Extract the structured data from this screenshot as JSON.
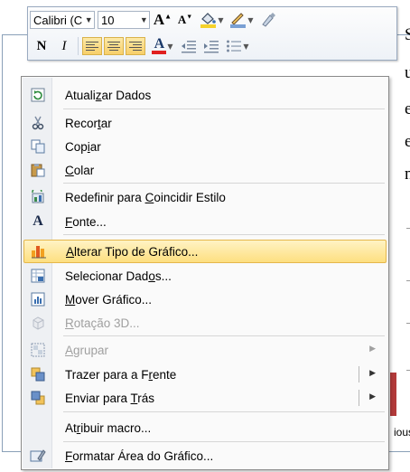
{
  "background": {
    "doc_lines": [
      "S",
      "u",
      "e",
      "e",
      "n"
    ],
    "partial_axis_label": "ious"
  },
  "mini_toolbar": {
    "font_name": "Calibri (C",
    "font_size": "10",
    "grow_font_glyph": "A",
    "shrink_font_glyph": "A",
    "bold_label": "N",
    "italic_label": "I",
    "font_color_glyph": "A",
    "icons": [
      "grow-font-icon",
      "shrink-font-icon",
      "fill-color-icon",
      "line-color-icon",
      "format-painter-icon",
      "bold-icon",
      "italic-icon",
      "align-left-icon",
      "align-center-icon",
      "align-right-icon",
      "font-color-icon",
      "decrease-indent-icon",
      "increase-indent-icon",
      "bullets-icon"
    ],
    "colors": {
      "fill": "#f5d22b",
      "line": "#7aa0d4",
      "font": "#e02020"
    }
  },
  "context_menu": {
    "items": [
      {
        "pre": "Atuali",
        "key": "z",
        "post": "ar Dados",
        "icon": "refresh-data-icon",
        "enabled": true
      },
      {
        "pre": "Recor",
        "key": "t",
        "post": "ar",
        "icon": "cut-icon",
        "enabled": true
      },
      {
        "pre": "Cop",
        "key": "i",
        "post": "ar",
        "icon": "copy-icon",
        "enabled": true
      },
      {
        "pre": "",
        "key": "C",
        "post": "olar",
        "icon": "paste-icon",
        "enabled": true
      },
      {
        "pre": "Redefinir para ",
        "key": "C",
        "post": "oincidir Estilo",
        "icon": "reset-style-icon",
        "enabled": true
      },
      {
        "pre": "",
        "key": "F",
        "post": "onte...",
        "icon": "font-icon",
        "enabled": true
      },
      {
        "pre": "",
        "key": "A",
        "post": "lterar Tipo de Gráfico...",
        "icon": "change-chart-type-icon",
        "enabled": true,
        "highlighted": true
      },
      {
        "pre": "Selecionar Dad",
        "key": "o",
        "post": "s...",
        "icon": "select-data-icon",
        "enabled": true
      },
      {
        "pre": "",
        "key": "M",
        "post": "over Gráfico...",
        "icon": "move-chart-icon",
        "enabled": true
      },
      {
        "pre": "",
        "key": "R",
        "post": "otação 3D...",
        "icon": "rotation-3d-icon",
        "enabled": false
      },
      {
        "pre": "",
        "key": "A",
        "post": "grupar",
        "icon": "group-icon",
        "enabled": false,
        "submenu": true
      },
      {
        "pre": "Trazer para a F",
        "key": "r",
        "post": "ente",
        "icon": "bring-forward-icon",
        "enabled": true,
        "submenu": true,
        "split": true
      },
      {
        "pre": "Enviar para ",
        "key": "T",
        "post": "rás",
        "icon": "send-backward-icon",
        "enabled": true,
        "submenu": true,
        "split": true
      },
      {
        "pre": "At",
        "key": "r",
        "post": "ibuir macro...",
        "icon": "assign-macro-icon",
        "enabled": true
      },
      {
        "pre": "",
        "key": "F",
        "post": "ormatar Área do Gráfico...",
        "icon": "format-chart-area-icon",
        "enabled": true
      }
    ],
    "submenu_arrow": "▶"
  }
}
